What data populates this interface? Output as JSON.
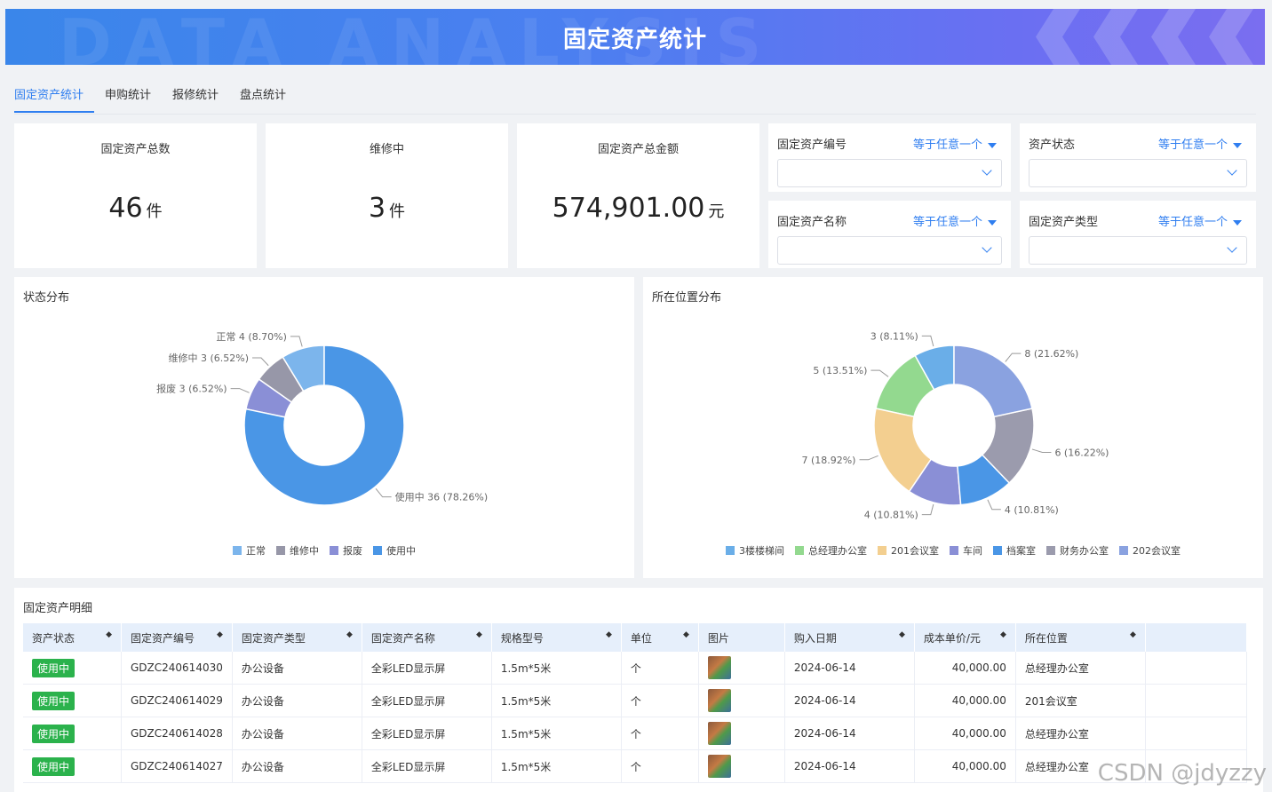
{
  "banner": {
    "title": "固定资产统计",
    "bg_text": "DATA ANALYSIS"
  },
  "tabs": [
    {
      "label": "固定资产统计",
      "active": true
    },
    {
      "label": "申购统计",
      "active": false
    },
    {
      "label": "报修统计",
      "active": false
    },
    {
      "label": "盘点统计",
      "active": false
    }
  ],
  "stats": [
    {
      "label": "固定资产总数",
      "value": "46",
      "unit": "件"
    },
    {
      "label": "维修中",
      "value": "3",
      "unit": "件"
    },
    {
      "label": "固定资产总金额",
      "value": "574,901.00",
      "unit": "元"
    }
  ],
  "filters": [
    {
      "label": "固定资产编号",
      "op": "等于任意一个"
    },
    {
      "label": "资产状态",
      "op": "等于任意一个"
    },
    {
      "label": "固定资产名称",
      "op": "等于任意一个"
    },
    {
      "label": "固定资产类型",
      "op": "等于任意一个"
    }
  ],
  "status_panel": {
    "title": "状态分布"
  },
  "location_panel": {
    "title": "所在位置分布"
  },
  "chart_data": [
    {
      "type": "pie",
      "title": "状态分布",
      "donut": true,
      "categories": [
        "正常",
        "维修中",
        "报废",
        "使用中"
      ],
      "values": [
        4,
        3,
        3,
        36
      ],
      "labels": [
        "正常 4 (8.70%)",
        "维修中 3 (6.52%)",
        "报废 3 (6.52%)",
        "使用中 36 (78.26%)"
      ],
      "colors": [
        "#7cb5ec",
        "#9797a8",
        "#8a8fd6",
        "#4a96e6"
      ],
      "legend": "bottom"
    },
    {
      "type": "pie",
      "title": "所在位置分布",
      "donut": true,
      "categories": [
        "3楼楼梯间",
        "总经理办公室",
        "201会议室",
        "车间",
        "档案室",
        "财务办公室",
        "202会议室"
      ],
      "values": [
        3,
        5,
        7,
        4,
        4,
        6,
        8
      ],
      "labels": [
        "3 (8.11%)",
        "5 (13.51%)",
        "7 (18.92%)",
        "4 (10.81%)",
        "4 (10.81%)",
        "6 (16.22%)",
        "8 (21.62%)"
      ],
      "colors": [
        "#6aaee8",
        "#93d98f",
        "#f3cf90",
        "#8a8fd6",
        "#4a96e6",
        "#9b9bad",
        "#8aa2e0"
      ],
      "legend": "bottom"
    }
  ],
  "table": {
    "title": "固定资产明细",
    "columns": [
      "资产状态",
      "固定资产编号",
      "固定资产类型",
      "固定资产名称",
      "规格型号",
      "单位",
      "图片",
      "购入日期",
      "成本单价/元",
      "所在位置"
    ],
    "rows": [
      [
        "使用中",
        "GDZC240614030",
        "办公设备",
        "全彩LED显示屏",
        "1.5m*5米",
        "个",
        "",
        "2024-06-14",
        "40,000.00",
        "总经理办公室"
      ],
      [
        "使用中",
        "GDZC240614029",
        "办公设备",
        "全彩LED显示屏",
        "1.5m*5米",
        "个",
        "",
        "2024-06-14",
        "40,000.00",
        "201会议室"
      ],
      [
        "使用中",
        "GDZC240614028",
        "办公设备",
        "全彩LED显示屏",
        "1.5m*5米",
        "个",
        "",
        "2024-06-14",
        "40,000.00",
        "总经理办公室"
      ],
      [
        "使用中",
        "GDZC240614027",
        "办公设备",
        "全彩LED显示屏",
        "1.5m*5米",
        "个",
        "",
        "2024-06-14",
        "40,000.00",
        "总经理办公室"
      ]
    ]
  },
  "watermark": "CSDN @jdyzzy"
}
